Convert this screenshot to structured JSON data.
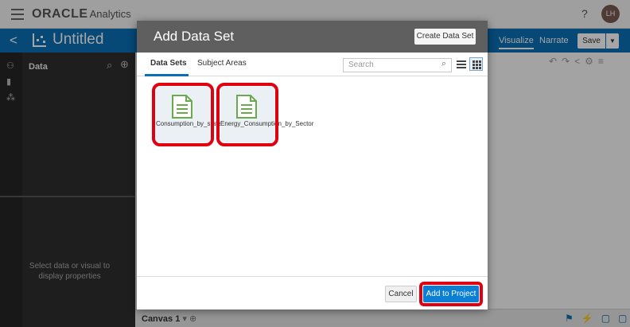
{
  "app": {
    "brand": "ORACLE",
    "brand_suffix": "Analytics",
    "help": "?",
    "user_initials": "LH"
  },
  "header": {
    "back": "<",
    "project_title": "Untitled",
    "tabs": [
      "Visualize",
      "Narrate"
    ],
    "save": "Save"
  },
  "left_panel": {
    "data_label": "Data",
    "properties_message": "Select data or visual to display properties"
  },
  "canvas": {
    "tab_label": "Canvas 1"
  },
  "modal": {
    "title": "Add Data Set",
    "create_button": "Create Data Set",
    "tabs": [
      "Data Sets",
      "Subject Areas"
    ],
    "search_placeholder": "Search",
    "datasets": [
      {
        "name": "Consumption_by_state_year"
      },
      {
        "name": "Energy_Consumption_by_Sector"
      }
    ],
    "cancel": "Cancel",
    "add_to_project": "Add to Project"
  },
  "colors": {
    "accent": "#0a6fb5",
    "highlight": "#e0000f",
    "file_icon": "#6aaa4f"
  },
  "icons": [
    "hamburger-icon",
    "back-icon",
    "chart-icon",
    "search-icon",
    "plus-icon",
    "list-view-icon",
    "grid-view-icon",
    "file-icon"
  ]
}
